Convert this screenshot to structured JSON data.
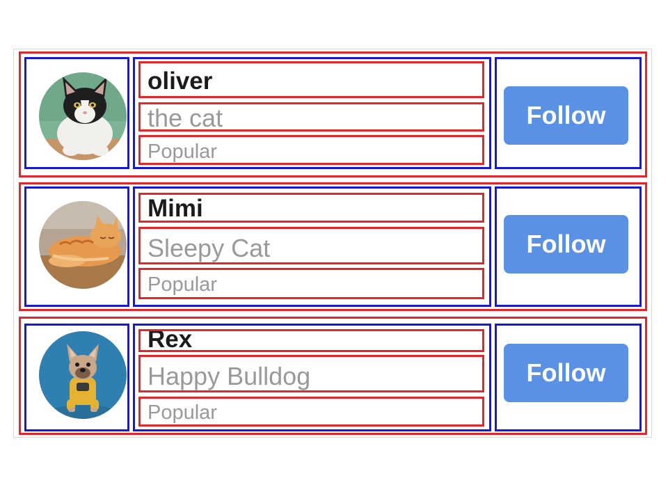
{
  "colors": {
    "row_border": "#e3262b",
    "cell_border": "#1717d8",
    "follow_button": "#5b91e4",
    "name_text": "#1b1b1b",
    "muted_text": "#999999"
  },
  "users": [
    {
      "name": "oliver",
      "description": "the cat",
      "tag": "Popular",
      "button_label": "Follow",
      "avatar_icon": "tuxedo-cat-avatar"
    },
    {
      "name": "Mimi",
      "description": "Sleepy Cat",
      "tag": "Popular",
      "button_label": "Follow",
      "avatar_icon": "orange-tabby-cat-avatar"
    },
    {
      "name": "Rex",
      "description": "Happy Bulldog",
      "tag": "Popular",
      "button_label": "Follow",
      "avatar_icon": "french-bulldog-avatar"
    }
  ]
}
